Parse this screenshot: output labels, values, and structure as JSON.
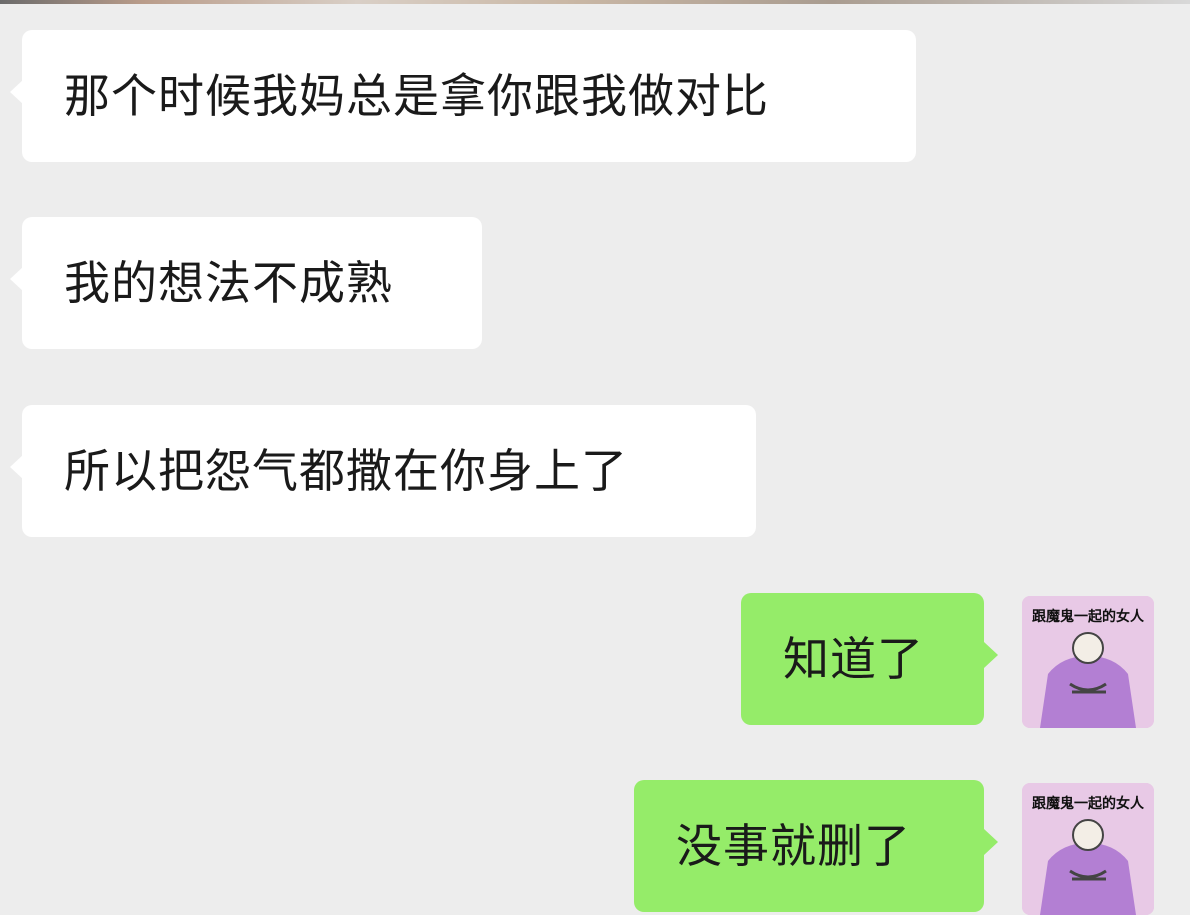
{
  "conversation": {
    "messages": [
      {
        "sender": "other",
        "text": "那个时候我妈总是拿你跟我做对比"
      },
      {
        "sender": "other",
        "text": "我的想法不成熟"
      },
      {
        "sender": "other",
        "text": "所以把怨气都撒在你身上了"
      },
      {
        "sender": "self",
        "text": "知道了"
      },
      {
        "sender": "self",
        "text": "没事就删了"
      }
    ]
  },
  "self_avatar": {
    "icon": "sticker-avatar-icon",
    "caption": "跟魔鬼一起的女人"
  },
  "colors": {
    "background": "#ededed",
    "incoming_bubble": "#ffffff",
    "outgoing_bubble": "#95ec69",
    "avatar_bg": "#e8c9e6",
    "avatar_figure": "#b37fd3"
  }
}
